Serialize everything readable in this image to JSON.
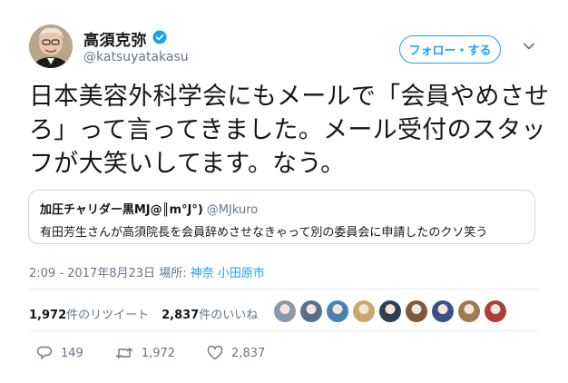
{
  "author": {
    "name": "高須克弥",
    "handle": "@katsuyatakasu"
  },
  "follow_label": "フォロー・する",
  "tweet_text": "日本美容外科学会にもメールで「会員やめさせろ」って言ってきました。メール受付のスタッフが大笑いしてます。なう。",
  "quote": {
    "name": "加圧チャリダー黒MJ@║m°J°)",
    "handle": "@MJkuro",
    "text": "有田芳生さんが高須院長を会員辞めさせなきゃって別の委員会に申請したのクソ笑う"
  },
  "meta": {
    "timestamp": "2:09 - 2017年8月23日",
    "location_prefix": "場所:",
    "location": "神奈 小田原市"
  },
  "stats": {
    "retweets_count": "1,972",
    "retweets_label": "件のリツイート",
    "likes_count": "2,837",
    "likes_label": "件のいいね"
  },
  "likers": [
    {
      "color": "#8a9aa8"
    },
    {
      "color": "#5b6f8c"
    },
    {
      "color": "#4a7fb5"
    },
    {
      "color": "#c8a86a"
    },
    {
      "color": "#2f3f52"
    },
    {
      "color": "#7c5a3b"
    },
    {
      "color": "#3c4f8a"
    },
    {
      "color": "#9e7b4f"
    },
    {
      "color": "#b03c3c"
    }
  ],
  "actions": {
    "replies": "149",
    "retweets": "1,972",
    "likes": "2,837"
  },
  "colors": {
    "accent": "#1da1f2",
    "muted": "#657786",
    "border": "#e6ecf0"
  }
}
